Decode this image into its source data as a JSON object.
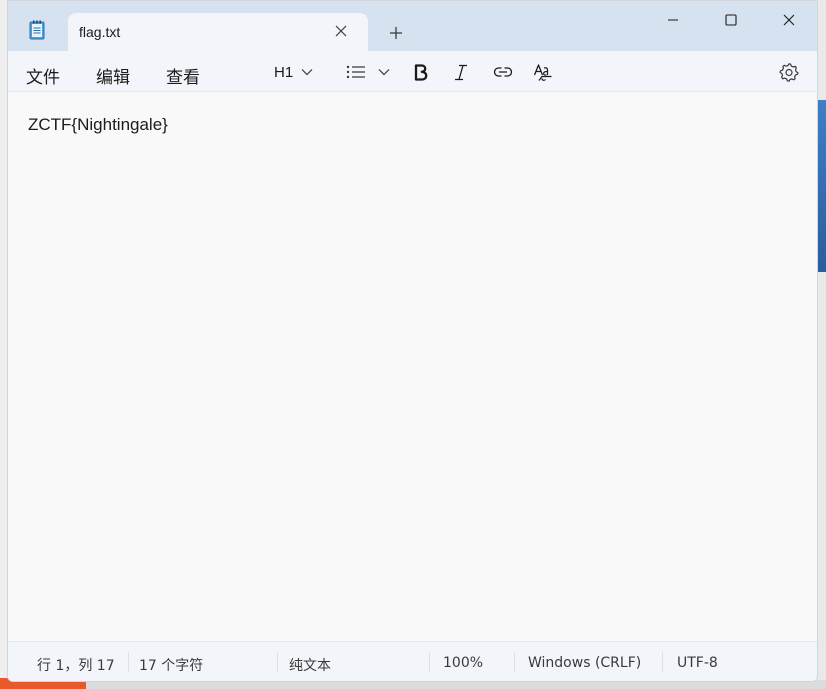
{
  "window": {
    "tab_title": "flag.txt",
    "menu": {
      "file": "文件",
      "edit": "编辑",
      "view": "查看"
    },
    "toolbar": {
      "heading": "H1"
    },
    "editor": {
      "content": "ZCTF{Nightingale}"
    },
    "status": {
      "position": "行 1，列 17",
      "char_count": "17 个字符",
      "format": "纯文本",
      "zoom": "100%",
      "line_ending": "Windows (CRLF)",
      "encoding": "UTF-8"
    },
    "icons": [
      "notepad-icon",
      "close-icon",
      "plus-icon",
      "minimize-icon",
      "maximize-icon",
      "window-close-icon",
      "chevron-down-icon",
      "list-icon",
      "bold-icon",
      "italic-icon",
      "link-icon",
      "spellcheck-icon",
      "gear-icon"
    ],
    "colors": {
      "titlebar": "#d6e2ef",
      "toolbar": "#f2f5f9",
      "editor_bg": "#f9f9fa",
      "text": "#1b1b1b"
    }
  }
}
